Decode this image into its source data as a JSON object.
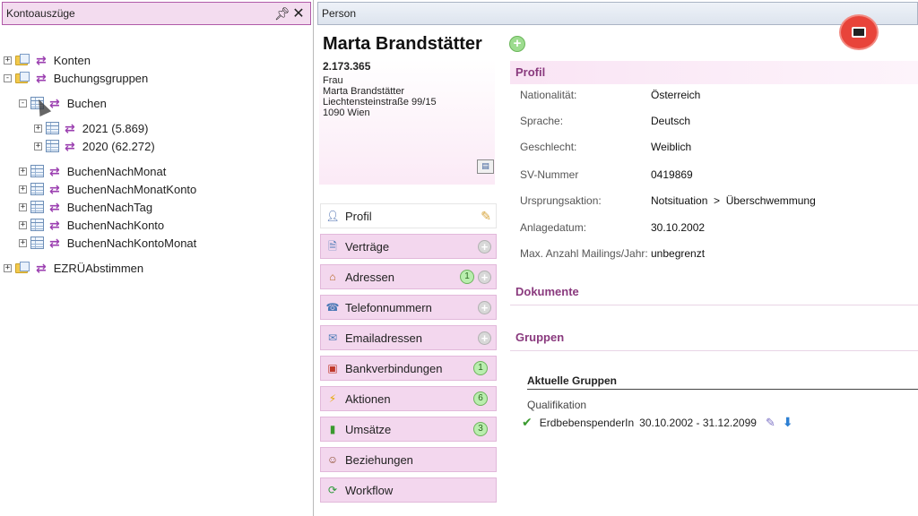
{
  "left_panel": {
    "title": "Kontoauszüge",
    "tree": [
      {
        "label": "Konten"
      },
      {
        "label": "Buchungsgruppen"
      },
      {
        "label": "Buchen"
      },
      {
        "label": "2021 (5.869)"
      },
      {
        "label": "2020 (62.272)"
      },
      {
        "label": "BuchenNachMonat"
      },
      {
        "label": "BuchenNachMonatKonto"
      },
      {
        "label": "BuchenNachTag"
      },
      {
        "label": "BuchenNachKonto"
      },
      {
        "label": "BuchenNachKontoMonat"
      },
      {
        "label": "EZRÜAbstimmen"
      }
    ]
  },
  "right_panel": {
    "tab_title": "Person",
    "person": {
      "name": "Marta Brandstätter",
      "number": "2.173.365",
      "salutation": "Frau",
      "address_name": "Marta Brandstätter",
      "street": "Liechtensteinstraße 99/15",
      "city": "1090 Wien"
    },
    "nav": [
      {
        "label": "Profil"
      },
      {
        "label": "Verträge"
      },
      {
        "label": "Adressen",
        "badge": "1"
      },
      {
        "label": "Telefonnummern"
      },
      {
        "label": "Emailadressen"
      },
      {
        "label": "Bankverbindungen",
        "badge": "1"
      },
      {
        "label": "Aktionen",
        "badge": "6"
      },
      {
        "label": "Umsätze",
        "badge": "3"
      },
      {
        "label": "Beziehungen"
      },
      {
        "label": "Workflow"
      }
    ],
    "profil": {
      "heading": "Profil",
      "rows": [
        {
          "key": "Nationalität:",
          "value": "Österreich"
        },
        {
          "key": "Sprache:",
          "value": "Deutsch"
        },
        {
          "key": "Geschlecht:",
          "value": "Weiblich"
        },
        {
          "key": "SV-Nummer",
          "value": "0419869"
        },
        {
          "key": "Ursprungsaktion:",
          "value": "Notsituation  >  Überschwemmung"
        },
        {
          "key": "Anlagedatum:",
          "value": "30.10.2002"
        },
        {
          "key": "Max. Anzahl Mailings/Jahr:",
          "value": "unbegrenzt"
        }
      ]
    },
    "dokumente_heading": "Dokumente",
    "gruppen": {
      "heading": "Gruppen",
      "current_label": "Aktuelle Gruppen",
      "category": "Qualifikation",
      "group_name": "ErdbebenspenderIn",
      "group_period": "30.10.2002 - 31.12.2099"
    }
  }
}
